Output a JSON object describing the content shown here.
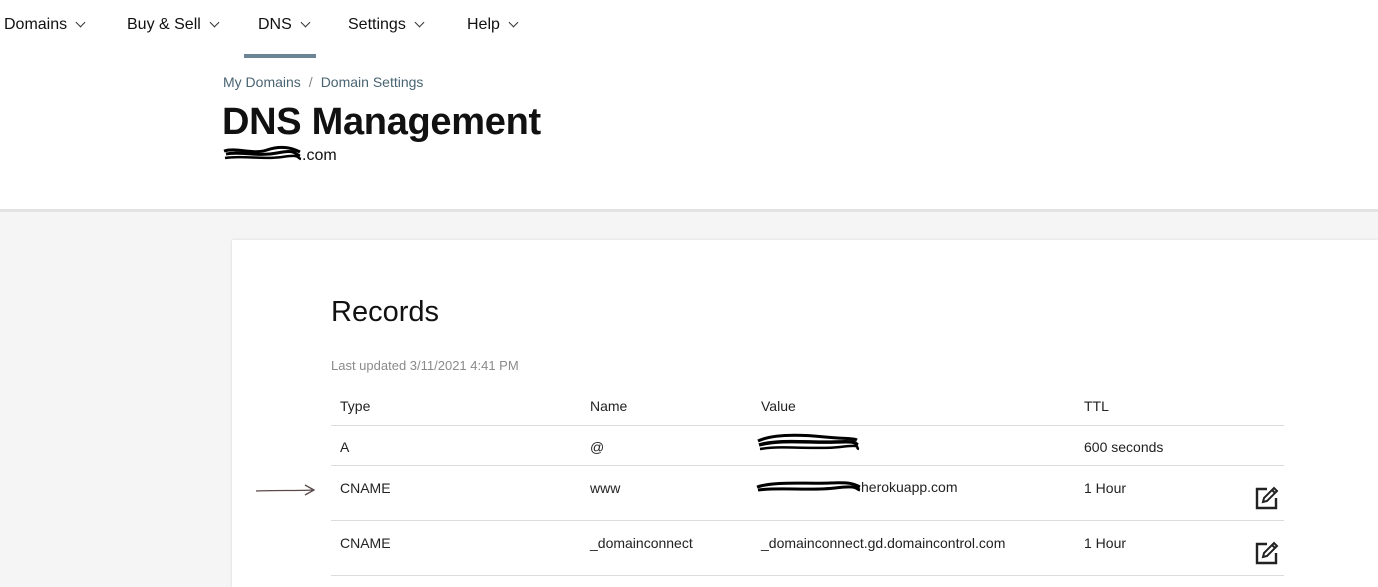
{
  "nav": {
    "items": [
      {
        "label": "Domains"
      },
      {
        "label": "Buy & Sell"
      },
      {
        "label": "DNS"
      },
      {
        "label": "Settings"
      },
      {
        "label": "Help"
      }
    ]
  },
  "breadcrumb": {
    "items": [
      "My Domains",
      "Domain Settings"
    ],
    "separator": "/"
  },
  "header": {
    "title": "DNS Management",
    "domain_suffix": ".com"
  },
  "records": {
    "title": "Records",
    "last_updated": "Last updated 3/11/2021 4:41 PM",
    "columns": [
      "Type",
      "Name",
      "Value",
      "TTL"
    ],
    "rows": [
      {
        "type": "A",
        "name": "@",
        "value": "",
        "ttl": "600 seconds"
      },
      {
        "type": "CNAME",
        "name": "www",
        "value": "herokuapp.com",
        "ttl": "1 Hour"
      },
      {
        "type": "CNAME",
        "name": "_domainconnect",
        "value": "_domainconnect.gd.domaincontrol.com",
        "ttl": "1 Hour"
      }
    ]
  },
  "colors": {
    "nav_active_underline": "#6b8594",
    "breadcrumb": "#4a6472",
    "muted_text": "#8a8a8a"
  }
}
